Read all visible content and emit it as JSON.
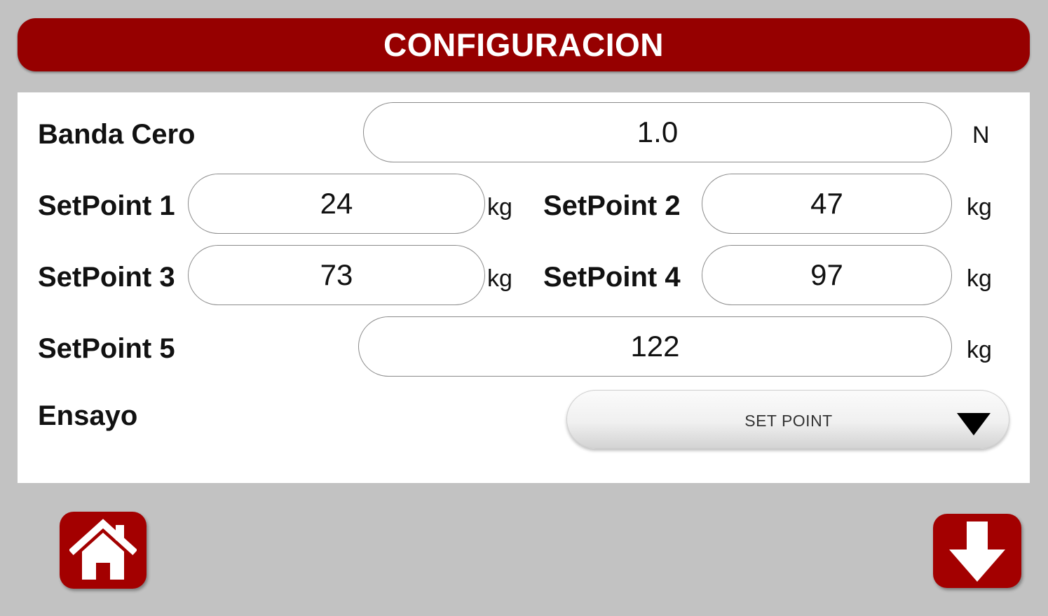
{
  "header": {
    "title": "CONFIGURACION"
  },
  "form": {
    "banda_cero": {
      "label": "Banda Cero",
      "value": "1.0",
      "unit": "N"
    },
    "setpoint1": {
      "label": "SetPoint 1",
      "value": "24",
      "unit": "kg"
    },
    "setpoint2": {
      "label": "SetPoint 2",
      "value": "47",
      "unit": "kg"
    },
    "setpoint3": {
      "label": "SetPoint 3",
      "value": "73",
      "unit": "kg"
    },
    "setpoint4": {
      "label": "SetPoint 4",
      "value": "97",
      "unit": "kg"
    },
    "setpoint5": {
      "label": "SetPoint 5",
      "value": "122",
      "unit": "kg"
    },
    "ensayo": {
      "label": "Ensayo",
      "selected": "SET POINT"
    }
  },
  "footer": {
    "home_icon": "home-icon",
    "save_icon": "down-arrow-icon"
  },
  "colors": {
    "accent": "#960000",
    "background": "#c2c2c2",
    "panel": "#ffffff"
  }
}
